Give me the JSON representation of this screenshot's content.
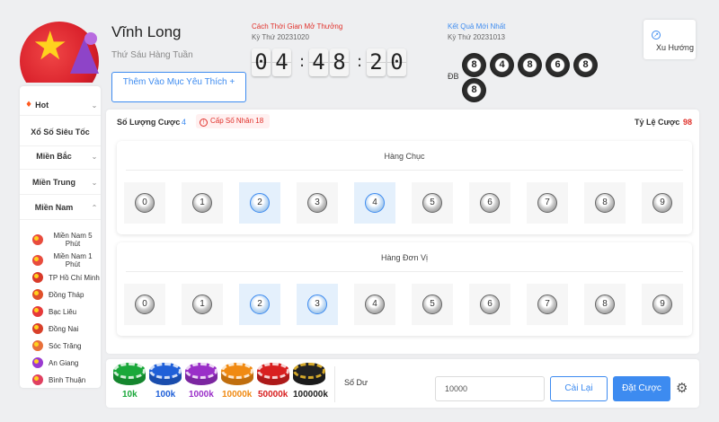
{
  "header": {
    "title": "Vĩnh Long",
    "subtitle": "Thứ Sáu Hàng Tuần",
    "favorite_button": "Thêm Vào Mục Yêu Thích +"
  },
  "countdown": {
    "title": "Cách Thời Gian Mở Thưởng",
    "draw": "Kỳ Thứ 20231020",
    "digits": [
      "0",
      "4",
      "4",
      "8",
      "2",
      "0"
    ],
    "separator": ":"
  },
  "result": {
    "title": "Kết Quả Mới Nhất",
    "draw": "Kỳ Thứ 20231013",
    "label": "ĐB",
    "balls": [
      "8",
      "4",
      "8",
      "6",
      "8",
      "8"
    ]
  },
  "trend": {
    "label": "Xu Hướng",
    "icon": "trend-chart-icon"
  },
  "sidebar": {
    "menu": [
      {
        "label": "Hot",
        "icon": "fire-icon",
        "chevron": "chevron-down-icon"
      },
      {
        "label": "Xổ Số Siêu Tốc",
        "chevron": ""
      },
      {
        "label": "Miền Bắc",
        "chevron": "chevron-down-icon"
      },
      {
        "label": "Miền Trung",
        "chevron": "chevron-down-icon"
      },
      {
        "label": "Miền Nam",
        "chevron": "chevron-up-icon"
      }
    ],
    "chevron_down": "⌄",
    "chevron_up": "⌃",
    "subitems": [
      {
        "label": "Miền Nam 5 Phút"
      },
      {
        "label": "Miền Nam 1 Phút"
      },
      {
        "label": "TP Hồ Chí Minh"
      },
      {
        "label": "Đồng Tháp"
      },
      {
        "label": "Bạc Liêu"
      },
      {
        "label": "Đồng Nai"
      },
      {
        "label": "Sóc Trăng"
      },
      {
        "label": "An Giang"
      },
      {
        "label": "Bình Thuận"
      }
    ]
  },
  "bet_info": {
    "count_label": "Số Lượng Cược",
    "count_value": "4",
    "level_badge": "Cấp Số Nhân 18",
    "odds_label": "Tỷ Lệ Cược",
    "odds_value": "98"
  },
  "rows": [
    {
      "title": "Hàng Chục",
      "numbers": [
        "0",
        "1",
        "2",
        "3",
        "4",
        "5",
        "6",
        "7",
        "8",
        "9"
      ],
      "selected": [
        2,
        4
      ]
    },
    {
      "title": "Hàng Đơn Vị",
      "numbers": [
        "0",
        "1",
        "2",
        "3",
        "4",
        "5",
        "6",
        "7",
        "8",
        "9"
      ],
      "selected": [
        2,
        3
      ]
    }
  ],
  "chips": [
    {
      "label": "10k",
      "color": "#1aa83a"
    },
    {
      "label": "100k",
      "color": "#2060d8"
    },
    {
      "label": "1000k",
      "color": "#9a2fc8"
    },
    {
      "label": "10000k",
      "color": "#f08a12"
    },
    {
      "label": "50000k",
      "color": "#d82020"
    },
    {
      "label": "100000k",
      "color": "#222222"
    }
  ],
  "footer": {
    "balance_label": "Số Dư",
    "balance_value": "10000",
    "reset_button": "Cài Lại",
    "bet_button": "Đặt Cược",
    "settings_icon": "gear-icon"
  },
  "colors": {
    "accent": "#3d8bf0",
    "danger": "#e0302a"
  }
}
